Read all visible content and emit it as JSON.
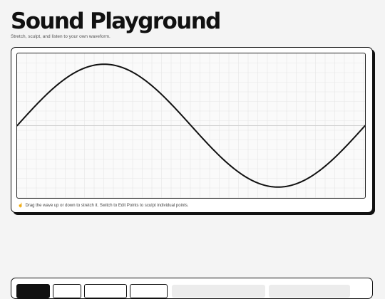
{
  "header": {
    "title": "Sound Playground",
    "subtitle": "Stretch, sculpt, and listen to your own waveform."
  },
  "canvas": {
    "hint_icon": "pointer-icon",
    "hint_glyph": "☝",
    "hint": "Drag the wave up or down to stretch it. Switch to Edit Points to sculpt individual points.",
    "grid": true,
    "wave_color": "#111111",
    "grid_color": "#e6e6e6",
    "axis_color": "#cfcfcf"
  },
  "wave": {
    "shape": "sine",
    "cycles": 1,
    "amplitude": 0.85
  },
  "toolbar": {
    "buttons": [
      "",
      "",
      "",
      ""
    ]
  }
}
